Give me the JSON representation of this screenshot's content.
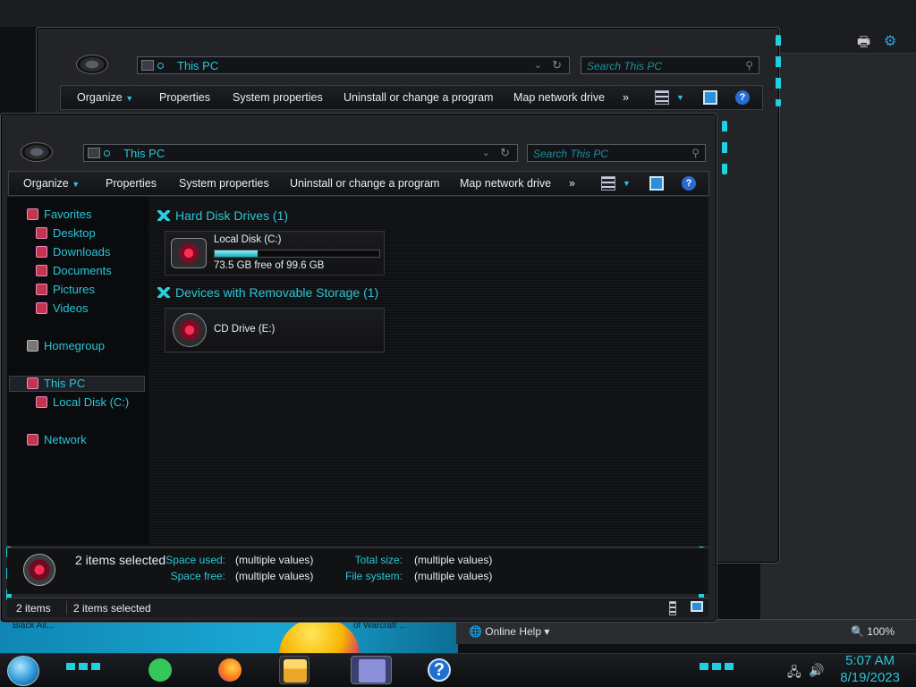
{
  "window_title": "This PC",
  "search_placeholder": "Search This PC",
  "toolbar": {
    "organize": "Organize",
    "properties": "Properties",
    "system_properties": "System properties",
    "uninstall": "Uninstall or change a program",
    "map_drive": "Map network drive",
    "more": "»"
  },
  "nav": {
    "favorites": "Favorites",
    "desktop": "Desktop",
    "downloads": "Downloads",
    "documents": "Documents",
    "pictures": "Pictures",
    "videos": "Videos",
    "homegroup": "Homegroup",
    "this_pc": "This PC",
    "local_disk": "Local Disk (C:)",
    "network": "Network"
  },
  "groups": {
    "hard_disks": "Hard Disk Drives (1)",
    "removable": "Devices with Removable Storage (1)"
  },
  "drives": {
    "c_name": "Local Disk (C:)",
    "c_free_text": "73.5 GB free of 99.6 GB",
    "c_used_fraction": 0.26,
    "cd_name": "CD Drive (E:)"
  },
  "details": {
    "selected": "2 items selected",
    "space_used_label": "Space used:",
    "space_used_value": "(multiple values)",
    "space_free_label": "Space free:",
    "space_free_value": "(multiple values)",
    "total_size_label": "Total size:",
    "total_size_value": "(multiple values)",
    "file_system_label": "File system:",
    "file_system_value": "(multiple values)"
  },
  "status": {
    "count": "2 items",
    "selected": "2 items selected"
  },
  "help_window": {
    "online_help": "Online Help",
    "zoom": "100%"
  },
  "wallpaper": {
    "text_left": "Black All...",
    "text_right": "of Warcraft ..."
  },
  "taskbar": {
    "time": "5:07 AM",
    "date": "8/19/2023",
    "help_glyph": "?"
  },
  "colors": {
    "accent": "#27c7d8",
    "neon": "#1fd1e0",
    "drive_icon": "#c2364b"
  }
}
